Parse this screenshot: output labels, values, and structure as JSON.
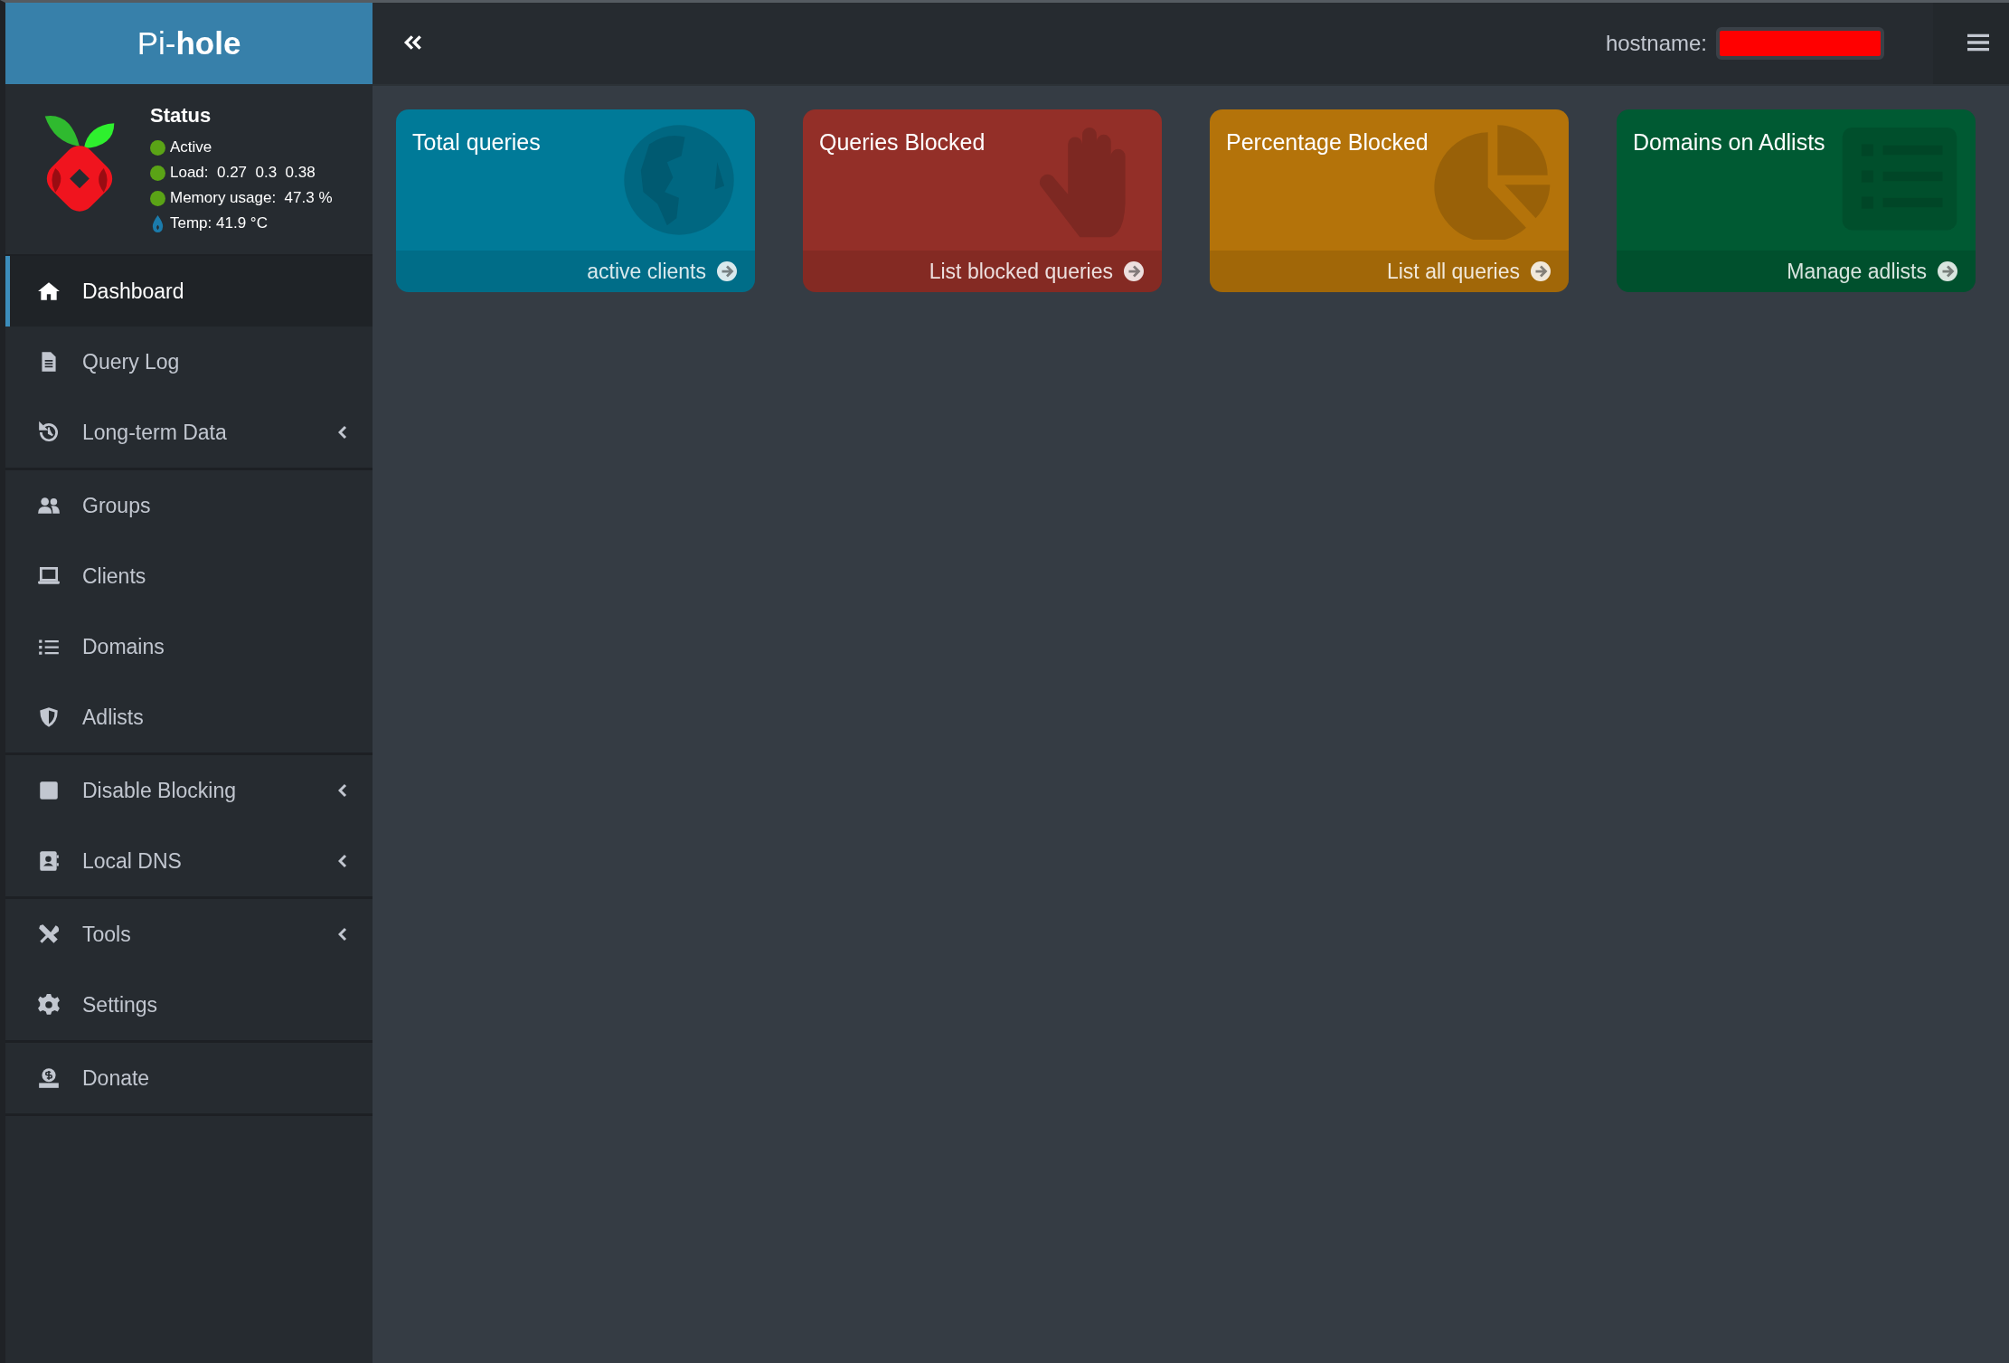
{
  "brand": {
    "light": "Pi-",
    "bold": "hole"
  },
  "status": {
    "title": "Status",
    "lines": [
      {
        "kind": "dot",
        "color": "#5aa316",
        "text": "Active"
      },
      {
        "kind": "dot",
        "color": "#5aa316",
        "text": "Load:  0.27  0.3  0.38"
      },
      {
        "kind": "dot",
        "color": "#5aa316",
        "text": "Memory usage:  47.3 %"
      },
      {
        "kind": "temp",
        "color": "#1b7bab",
        "text": "Temp: 41.9 °C"
      }
    ]
  },
  "sidebar": {
    "groups": [
      {
        "items": [
          {
            "label": "Dashboard",
            "selected": true,
            "expandable": false
          },
          {
            "label": "Query Log",
            "selected": false,
            "expandable": false
          },
          {
            "label": "Long-term Data",
            "selected": false,
            "expandable": true
          }
        ]
      },
      {
        "items": [
          {
            "label": "Groups",
            "selected": false,
            "expandable": false
          },
          {
            "label": "Clients",
            "selected": false,
            "expandable": false
          },
          {
            "label": "Domains",
            "selected": false,
            "expandable": false
          },
          {
            "label": "Adlists",
            "selected": false,
            "expandable": false
          }
        ]
      },
      {
        "items": [
          {
            "label": "Disable Blocking",
            "selected": false,
            "expandable": true
          },
          {
            "label": "Local DNS",
            "selected": false,
            "expandable": true
          }
        ]
      },
      {
        "items": [
          {
            "label": "Tools",
            "selected": false,
            "expandable": true
          },
          {
            "label": "Settings",
            "selected": false,
            "expandable": false
          }
        ]
      },
      {
        "items": [
          {
            "label": "Donate",
            "selected": false,
            "expandable": false
          }
        ]
      }
    ]
  },
  "header": {
    "hostname_label": "hostname:"
  },
  "cards": [
    {
      "color": "#007a98",
      "title": "Total queries",
      "link": "active clients"
    },
    {
      "color": "#932f28",
      "title": "Queries Blocked",
      "link": "List blocked queries"
    },
    {
      "color": "#b4730a",
      "title": "Percentage Blocked",
      "link": "List all queries"
    },
    {
      "color": "#005a33",
      "title": "Domains on Adlists",
      "link": "Manage adlists"
    }
  ]
}
